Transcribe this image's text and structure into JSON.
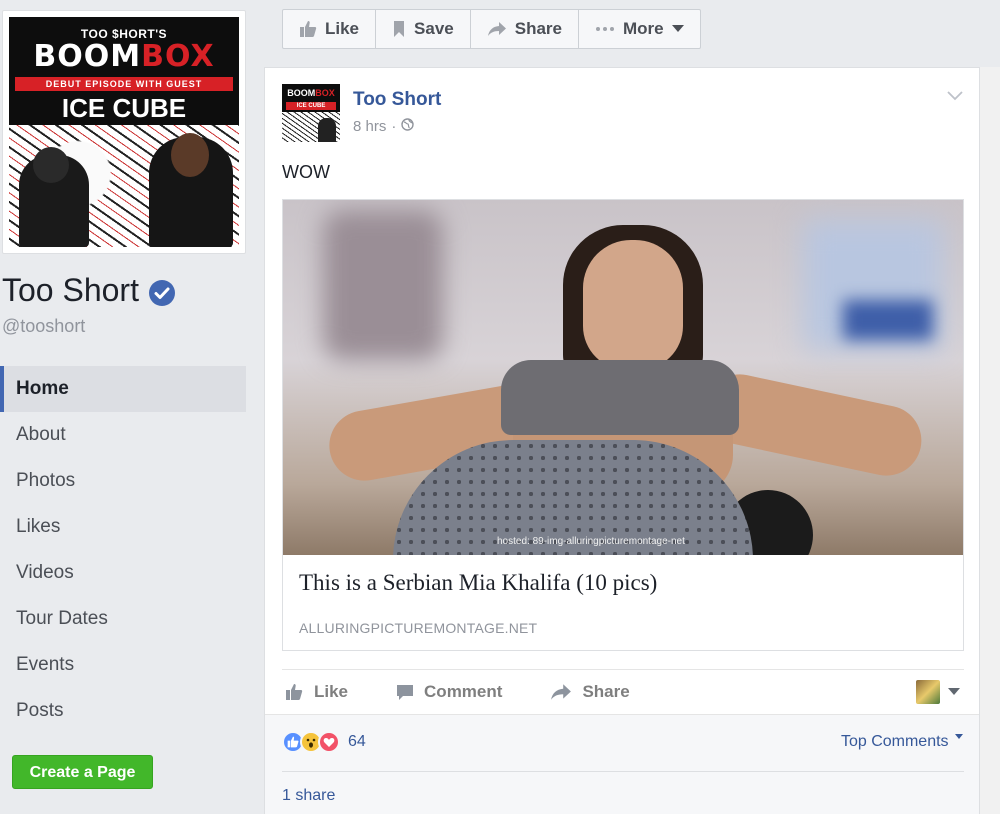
{
  "page": {
    "cover": {
      "line1": "TOO $HORT'S",
      "line2_a": "BOOM",
      "line2_b": "BOX",
      "line3": "DEBUT EPISODE WITH GUEST",
      "line4": "ICE CUBE"
    },
    "name": "Too Short",
    "handle": "@tooshort",
    "verified_color": "#4267b2"
  },
  "nav": {
    "items": [
      {
        "label": "Home",
        "active": true
      },
      {
        "label": "About"
      },
      {
        "label": "Photos"
      },
      {
        "label": "Likes"
      },
      {
        "label": "Videos"
      },
      {
        "label": "Tour Dates"
      },
      {
        "label": "Events"
      },
      {
        "label": "Posts"
      }
    ]
  },
  "create_page": {
    "label": "Create a Page",
    "color": "#42b72a"
  },
  "actionbar": {
    "like": "Like",
    "save": "Save",
    "share": "Share",
    "more": "More"
  },
  "post": {
    "author": "Too Short",
    "time": "8 hrs",
    "privacy_icon": "globe-icon",
    "text": "WOW",
    "link": {
      "image_watermark": "hosted: 89-img-alluringpicturemontage-net",
      "title": "This is a Serbian Mia Khalifa (10 pics)",
      "domain": "ALLURINGPICTUREMONTAGE.NET"
    },
    "actions": {
      "like": "Like",
      "comment": "Comment",
      "share": "Share"
    },
    "reactions": {
      "types": [
        "like",
        "wow",
        "love"
      ],
      "count": "64"
    },
    "top_comments": "Top Comments",
    "shares": "1 share"
  },
  "colors": {
    "link_blue": "#365899",
    "fb_blue": "#4267b2",
    "bg": "#e9ebee"
  }
}
